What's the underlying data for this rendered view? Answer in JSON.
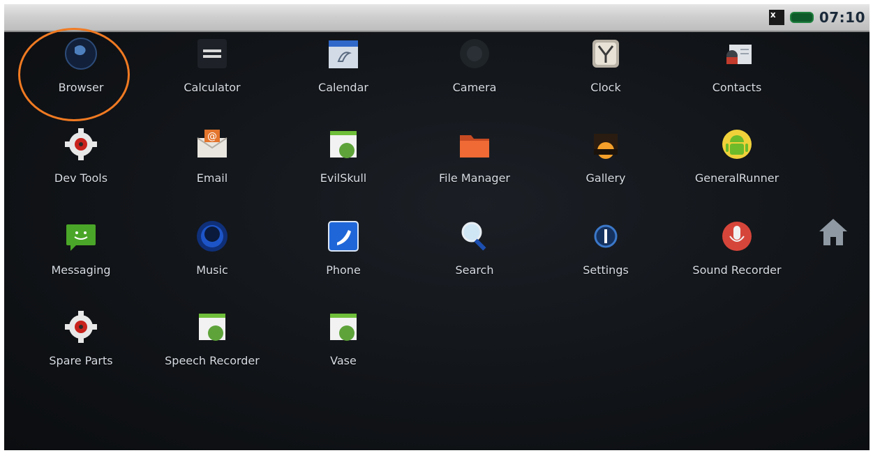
{
  "status_bar": {
    "signal_icon": "no-signal-icon",
    "signal_glyph": "x",
    "battery_icon": "battery-icon",
    "time": "07:10"
  },
  "apps": [
    {
      "label": "Browser",
      "icon": "globe-icon"
    },
    {
      "label": "Calculator",
      "icon": "calculator-icon"
    },
    {
      "label": "Calendar",
      "icon": "calendar-icon"
    },
    {
      "label": "Camera",
      "icon": "camera-icon"
    },
    {
      "label": "Clock",
      "icon": "clock-icon"
    },
    {
      "label": "Contacts",
      "icon": "contacts-icon"
    },
    {
      "label": "Dev Tools",
      "icon": "gear-icon"
    },
    {
      "label": "Email",
      "icon": "email-icon"
    },
    {
      "label": "EvilSkull",
      "icon": "android-app-icon"
    },
    {
      "label": "File Manager",
      "icon": "folder-icon"
    },
    {
      "label": "Gallery",
      "icon": "gallery-icon"
    },
    {
      "label": "GeneralRunner",
      "icon": "android-robot-icon"
    },
    {
      "label": "Messaging",
      "icon": "messaging-icon"
    },
    {
      "label": "Music",
      "icon": "music-icon"
    },
    {
      "label": "Phone",
      "icon": "phone-icon"
    },
    {
      "label": "Search",
      "icon": "magnifier-icon"
    },
    {
      "label": "Settings",
      "icon": "settings-icon"
    },
    {
      "label": "Sound Recorder",
      "icon": "microphone-icon"
    },
    {
      "label": "Spare Parts",
      "icon": "gear-icon"
    },
    {
      "label": "Speech Recorder",
      "icon": "android-app-icon"
    },
    {
      "label": "Vase",
      "icon": "android-app-icon"
    }
  ],
  "highlighted_app": "Browser",
  "highlight_color": "#f07a22",
  "home_icon": "home-icon"
}
